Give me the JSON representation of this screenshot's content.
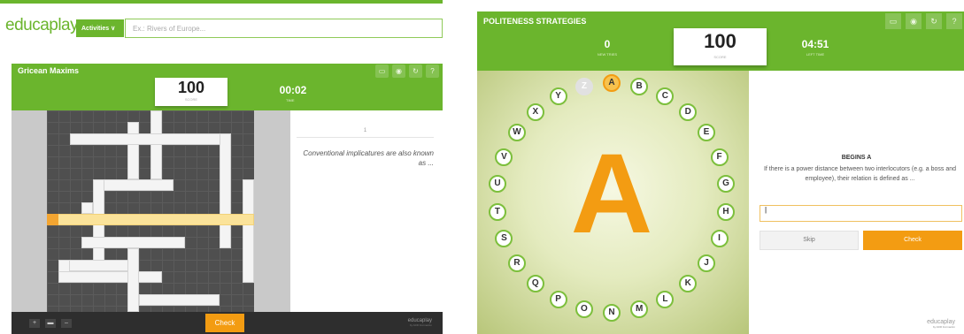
{
  "left": {
    "logo": "educaplay",
    "activities_label": "Activities ∨",
    "search_placeholder": "Ex.: Rivers of Europe...",
    "title": "Gricean Maxims",
    "score": "100",
    "score_label": "SCORE",
    "time": "00:02",
    "time_label": "TIME",
    "clue_number": "1",
    "clue_text": "Conventional implicatures are also known as ...",
    "ctrl_plus": "+",
    "ctrl_minus": "–",
    "check_label": "Check",
    "brand": "educaplay",
    "brand_sub": "by ADR Formación"
  },
  "right": {
    "title": "POLITENESS STRATEGIES",
    "tries_value": "0",
    "tries_label": "NEW TRIES",
    "score": "100",
    "score_label": "SCORE",
    "time": "04:51",
    "time_label": "LEFT TIME",
    "big_letter": "A",
    "letters": [
      "Z",
      "A",
      "B",
      "C",
      "D",
      "E",
      "F",
      "G",
      "H",
      "I",
      "J",
      "K",
      "L",
      "M",
      "N",
      "O",
      "P",
      "Q",
      "R",
      "S",
      "T",
      "U",
      "V",
      "W",
      "X",
      "Y"
    ],
    "current_letter": "A",
    "faded_letter": "Z",
    "question_title": "BEGINS A",
    "question_text": "If there is a power distance between two interlocutors (e.g. a boss and employee), their relation is defined as ...",
    "answer_value": "|",
    "skip_label": "Skip",
    "check_label": "Check",
    "brand": "educaplay",
    "brand_sub": "by ADR Formación"
  },
  "colors": {
    "brand_green": "#6bb52d",
    "accent_orange": "#f39c12",
    "letter_border": "#7cbf3c"
  },
  "icons": [
    "fullscreen-icon",
    "eye-icon",
    "restart-icon",
    "help-icon"
  ]
}
